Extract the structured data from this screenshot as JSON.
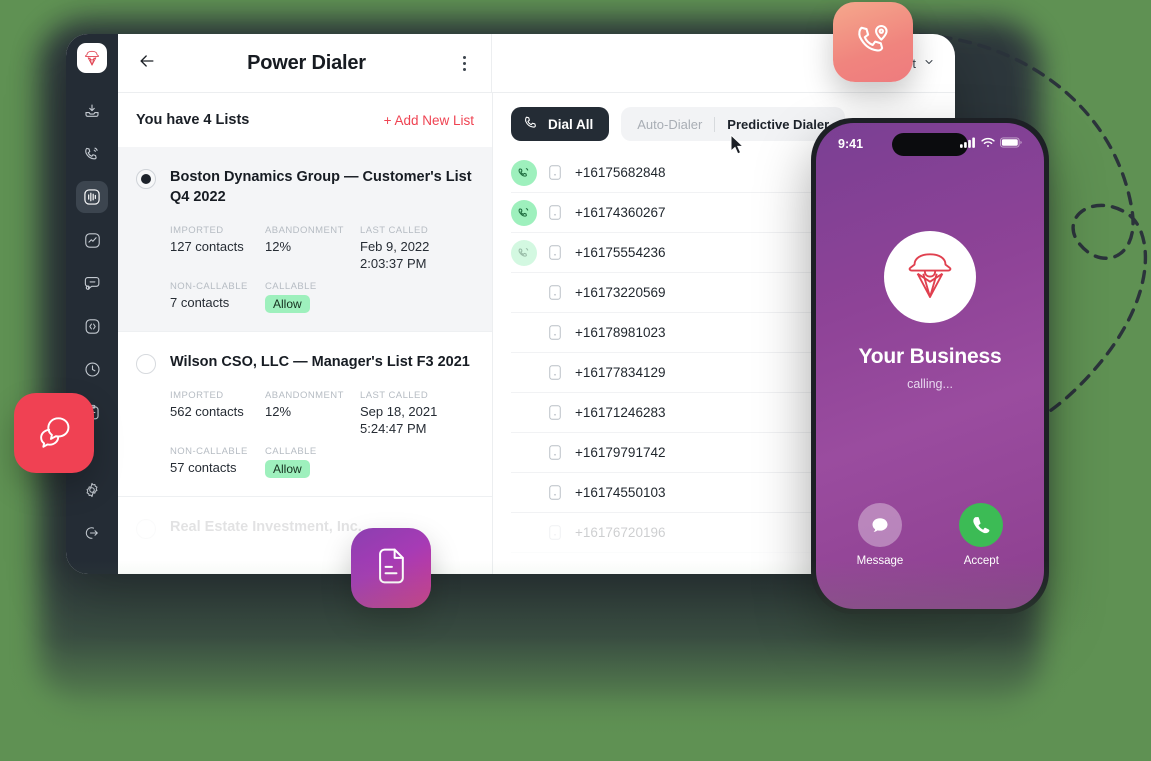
{
  "sidebar": {
    "logo_name": "brand-logo",
    "items": [
      {
        "name": "inbox",
        "icon": "inbox-icon",
        "active": false
      },
      {
        "name": "calls",
        "icon": "phone-ring-icon",
        "active": false
      },
      {
        "name": "power-dialer",
        "icon": "waveform-icon",
        "active": true
      },
      {
        "name": "analytics",
        "icon": "analytics-icon",
        "active": false
      },
      {
        "name": "messages",
        "icon": "chat-bubble-icon",
        "active": false
      },
      {
        "name": "developers",
        "icon": "code-icon",
        "active": false
      },
      {
        "name": "history",
        "icon": "clock-icon",
        "active": false
      },
      {
        "name": "tasks",
        "icon": "clipboard-icon",
        "active": false
      }
    ],
    "bottom_items": [
      {
        "name": "settings",
        "icon": "gear-icon"
      },
      {
        "name": "logout",
        "icon": "logout-icon"
      }
    ]
  },
  "topbar": {
    "back_icon": "arrow-left-icon",
    "title": "Power Dialer",
    "menu_icon": "kebab-menu-icon",
    "account_label": "ount",
    "account_chevron": "chevron-down-icon"
  },
  "lists": {
    "header_title": "You have 4 Lists",
    "add_label": "+ Add New List",
    "labels": {
      "imported": "IMPORTED",
      "abandonment": "ABANDONMENT",
      "last_called": "LAST CALLED",
      "non_callable": "NON-CALLABLE",
      "callable": "CALLABLE"
    },
    "items": [
      {
        "name": "Boston Dynamics Group — Customer's List Q4 2022",
        "selected": true,
        "imported": "127 contacts",
        "abandonment": "12%",
        "last_called_date": "Feb 9, 2022",
        "last_called_time": "2:03:37 PM",
        "non_callable": "7 contacts",
        "callable": "Allow"
      },
      {
        "name": "Wilson CSO, LLC — Manager's List F3 2021",
        "selected": false,
        "imported": "562 contacts",
        "abandonment": "12%",
        "last_called_date": "Sep 18, 2021",
        "last_called_time": "5:24:47 PM",
        "non_callable": "57 contacts",
        "callable": "Allow"
      },
      {
        "name": "Real Estate Investment, Inc.",
        "selected": false,
        "faded": true,
        "imported": "",
        "abandonment": "",
        "last_called_date": "",
        "last_called_time": "",
        "non_callable": "",
        "callable": ""
      }
    ]
  },
  "dialer": {
    "dial_all_label": "Dial All",
    "dial_all_icon": "phone-icon",
    "modes": [
      {
        "label": "Auto-Dialer",
        "active": false
      },
      {
        "label": "Predictive Dialer",
        "active": true
      }
    ],
    "numbers": [
      {
        "number": "+16175682848",
        "calling": true,
        "dim": false,
        "faded": false
      },
      {
        "number": "+16174360267",
        "calling": true,
        "dim": false,
        "faded": false
      },
      {
        "number": "+16175554236",
        "calling": true,
        "dim": true,
        "faded": false
      },
      {
        "number": "+16173220569",
        "calling": false,
        "dim": false,
        "faded": false
      },
      {
        "number": "+16178981023",
        "calling": false,
        "dim": false,
        "faded": false
      },
      {
        "number": "+16177834129",
        "calling": false,
        "dim": false,
        "faded": false
      },
      {
        "number": "+16171246283",
        "calling": false,
        "dim": false,
        "faded": false
      },
      {
        "number": "+16179791742",
        "calling": false,
        "dim": false,
        "faded": false
      },
      {
        "number": "+16174550103",
        "calling": false,
        "dim": false,
        "faded": false
      },
      {
        "number": "+16176720196",
        "calling": false,
        "dim": false,
        "faded": true
      }
    ]
  },
  "phone": {
    "status_time": "9:41",
    "signal_icon": "cellular-signal-icon",
    "wifi_icon": "wifi-icon",
    "battery_icon": "battery-icon",
    "avatar_icon": "brand-logo",
    "caller_name": "Your Business",
    "caller_status": "calling...",
    "actions": [
      {
        "label": "Message",
        "icon": "message-bubble-icon"
      },
      {
        "label": "Accept",
        "icon": "phone-icon"
      }
    ]
  },
  "fabs": [
    {
      "name": "chat-badge",
      "icon": "double-chat-bubble-icon",
      "color": "#f04153"
    },
    {
      "name": "document-badge",
      "icon": "document-icon",
      "color": "#a63bb5"
    },
    {
      "name": "call-location-badge",
      "icon": "phone-location-icon",
      "color": "#f0847e"
    }
  ],
  "colors": {
    "accent_red": "#ef4352",
    "sidebar_dark": "#242c35",
    "allow_green": "#9ef0bd",
    "accept_green": "#3cbb55",
    "backdrop_green": "#5f9153"
  }
}
